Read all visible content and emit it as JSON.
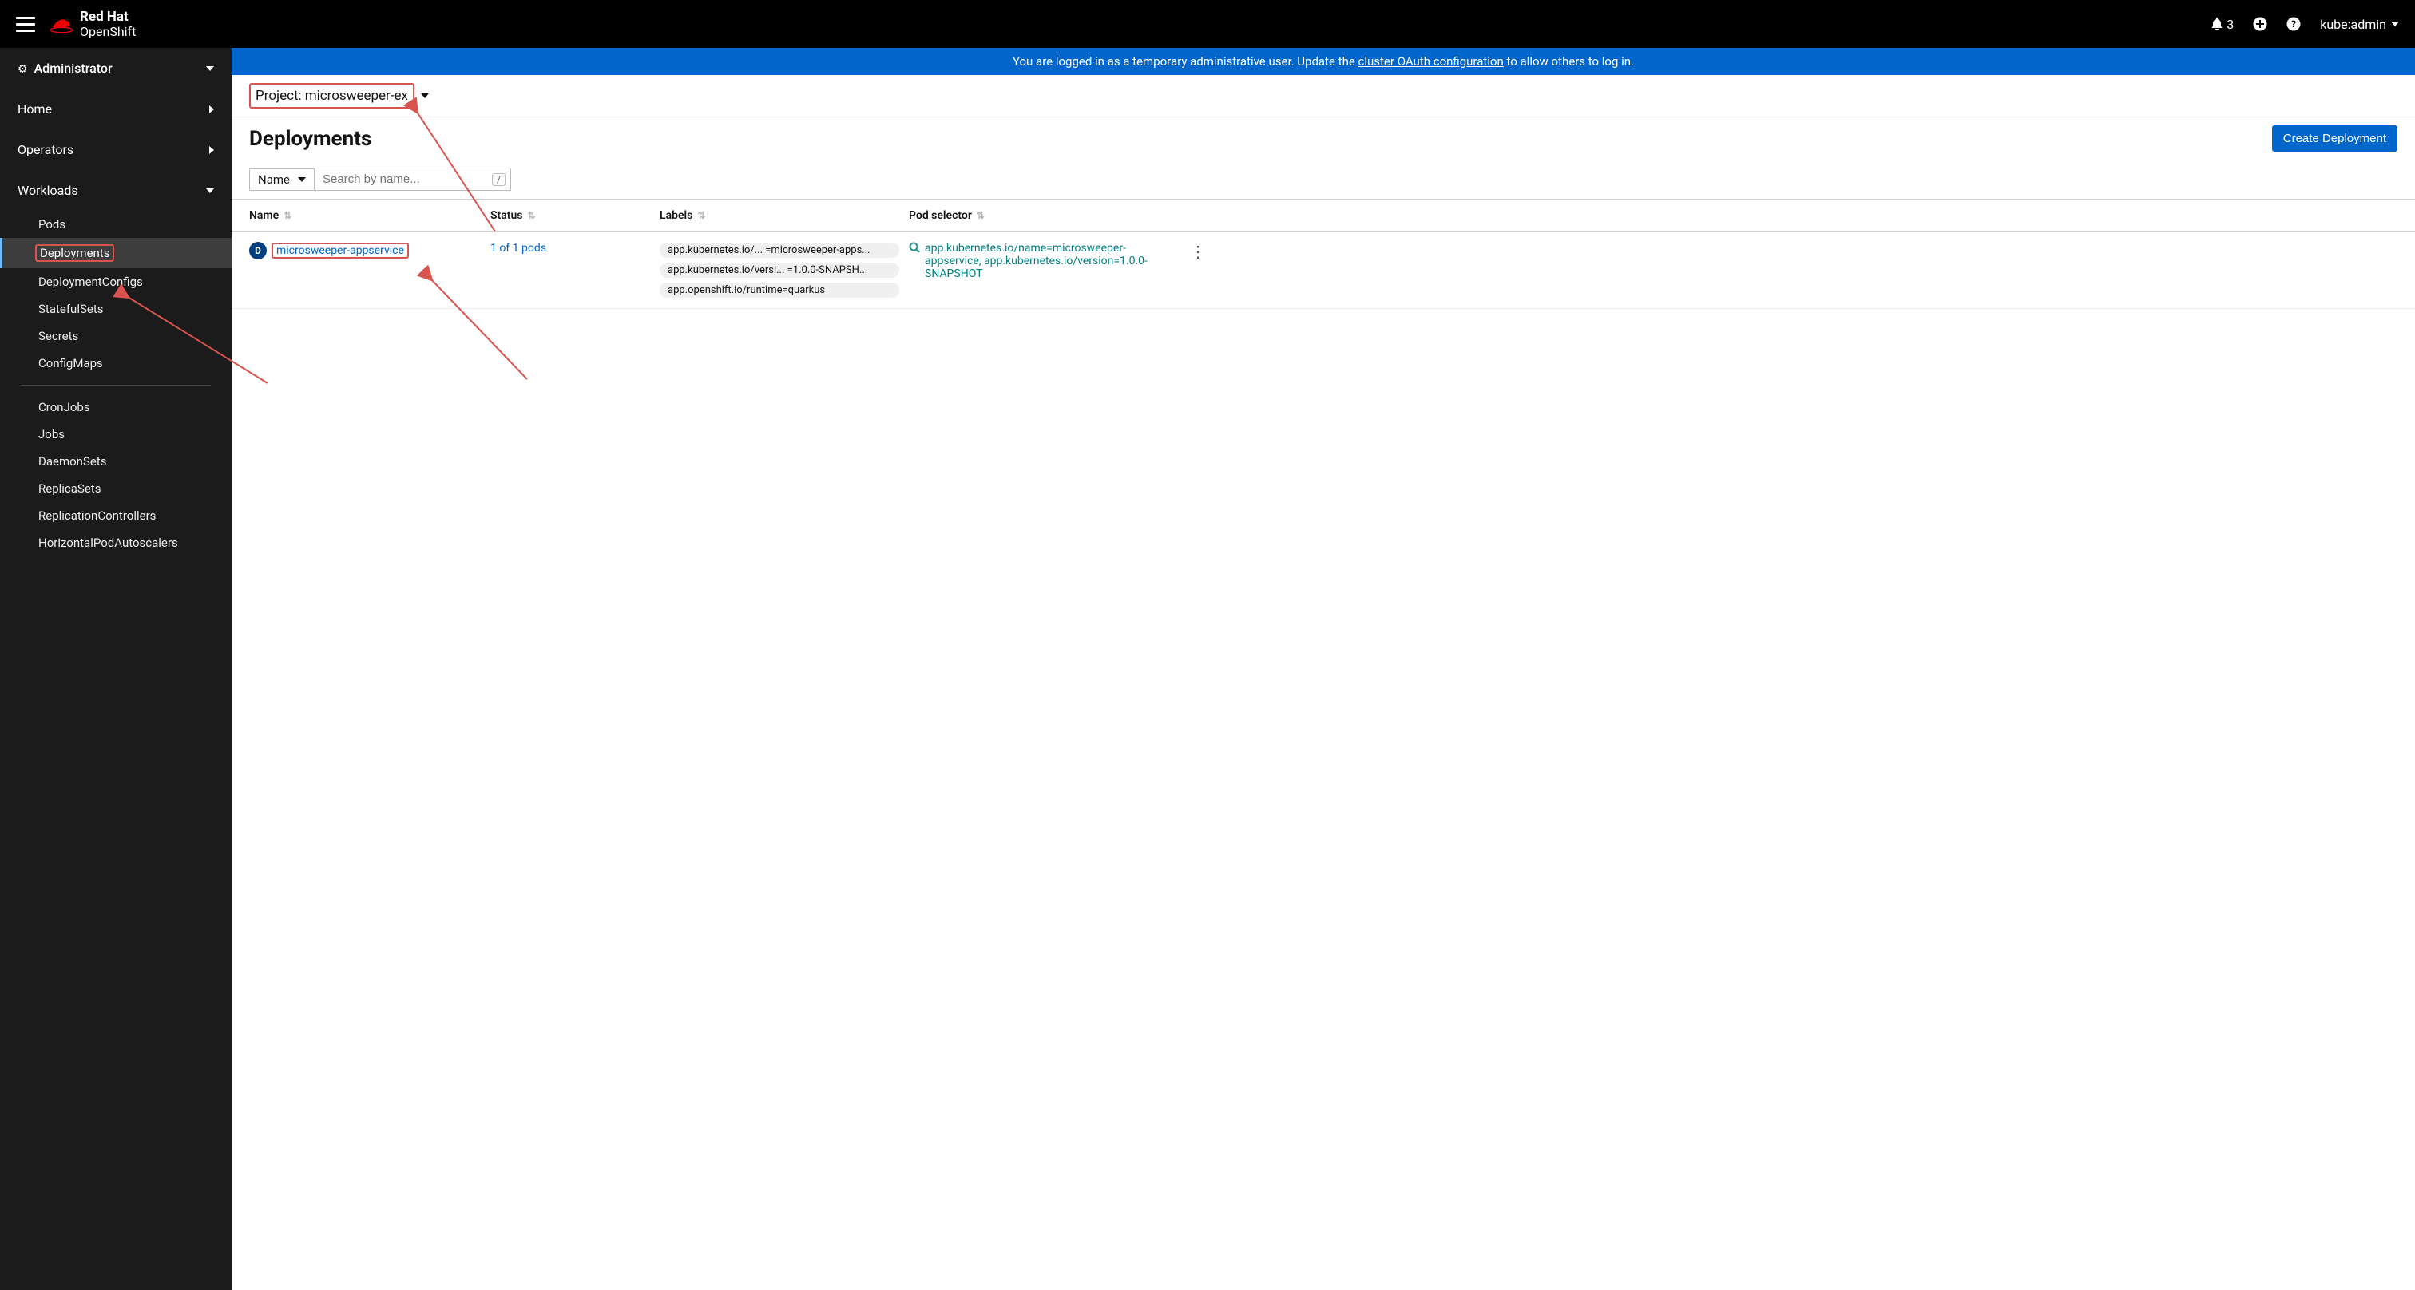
{
  "topbar": {
    "brand_line1": "Red Hat",
    "brand_line2": "OpenShift",
    "notif_count": "3",
    "user": "kube:admin"
  },
  "sidebar": {
    "perspective": "Administrator",
    "sections": {
      "home": "Home",
      "operators": "Operators",
      "workloads": "Workloads"
    },
    "workloads_items": [
      "Pods",
      "Deployments",
      "DeploymentConfigs",
      "StatefulSets",
      "Secrets",
      "ConfigMaps",
      "CronJobs",
      "Jobs",
      "DaemonSets",
      "ReplicaSets",
      "ReplicationControllers",
      "HorizontalPodAutoscalers"
    ]
  },
  "banner": {
    "prefix": "You are logged in as a temporary administrative user. Update the ",
    "link": "cluster OAuth configuration",
    "suffix": " to allow others to log in."
  },
  "project": {
    "prefix": "Project:",
    "name": "microsweeper-ex"
  },
  "page": {
    "title": "Deployments",
    "create_btn": "Create Deployment"
  },
  "filter": {
    "type": "Name",
    "placeholder": "Search by name...",
    "shortcut": "/"
  },
  "table": {
    "columns": {
      "name": "Name",
      "status": "Status",
      "labels": "Labels",
      "selector": "Pod selector"
    },
    "rows": [
      {
        "badge": "D",
        "name": "microsweeper-appservice",
        "status": "1 of 1 pods",
        "labels": [
          "app.kubernetes.io/... =microsweeper-apps...",
          "app.kubernetes.io/versi... =1.0.0-SNAPSH...",
          "app.openshift.io/runtime=quarkus"
        ],
        "selector": "app.kubernetes.io/name=microsweeper-appservice, app.kubernetes.io/version=1.0.0-SNAPSHOT"
      }
    ]
  }
}
